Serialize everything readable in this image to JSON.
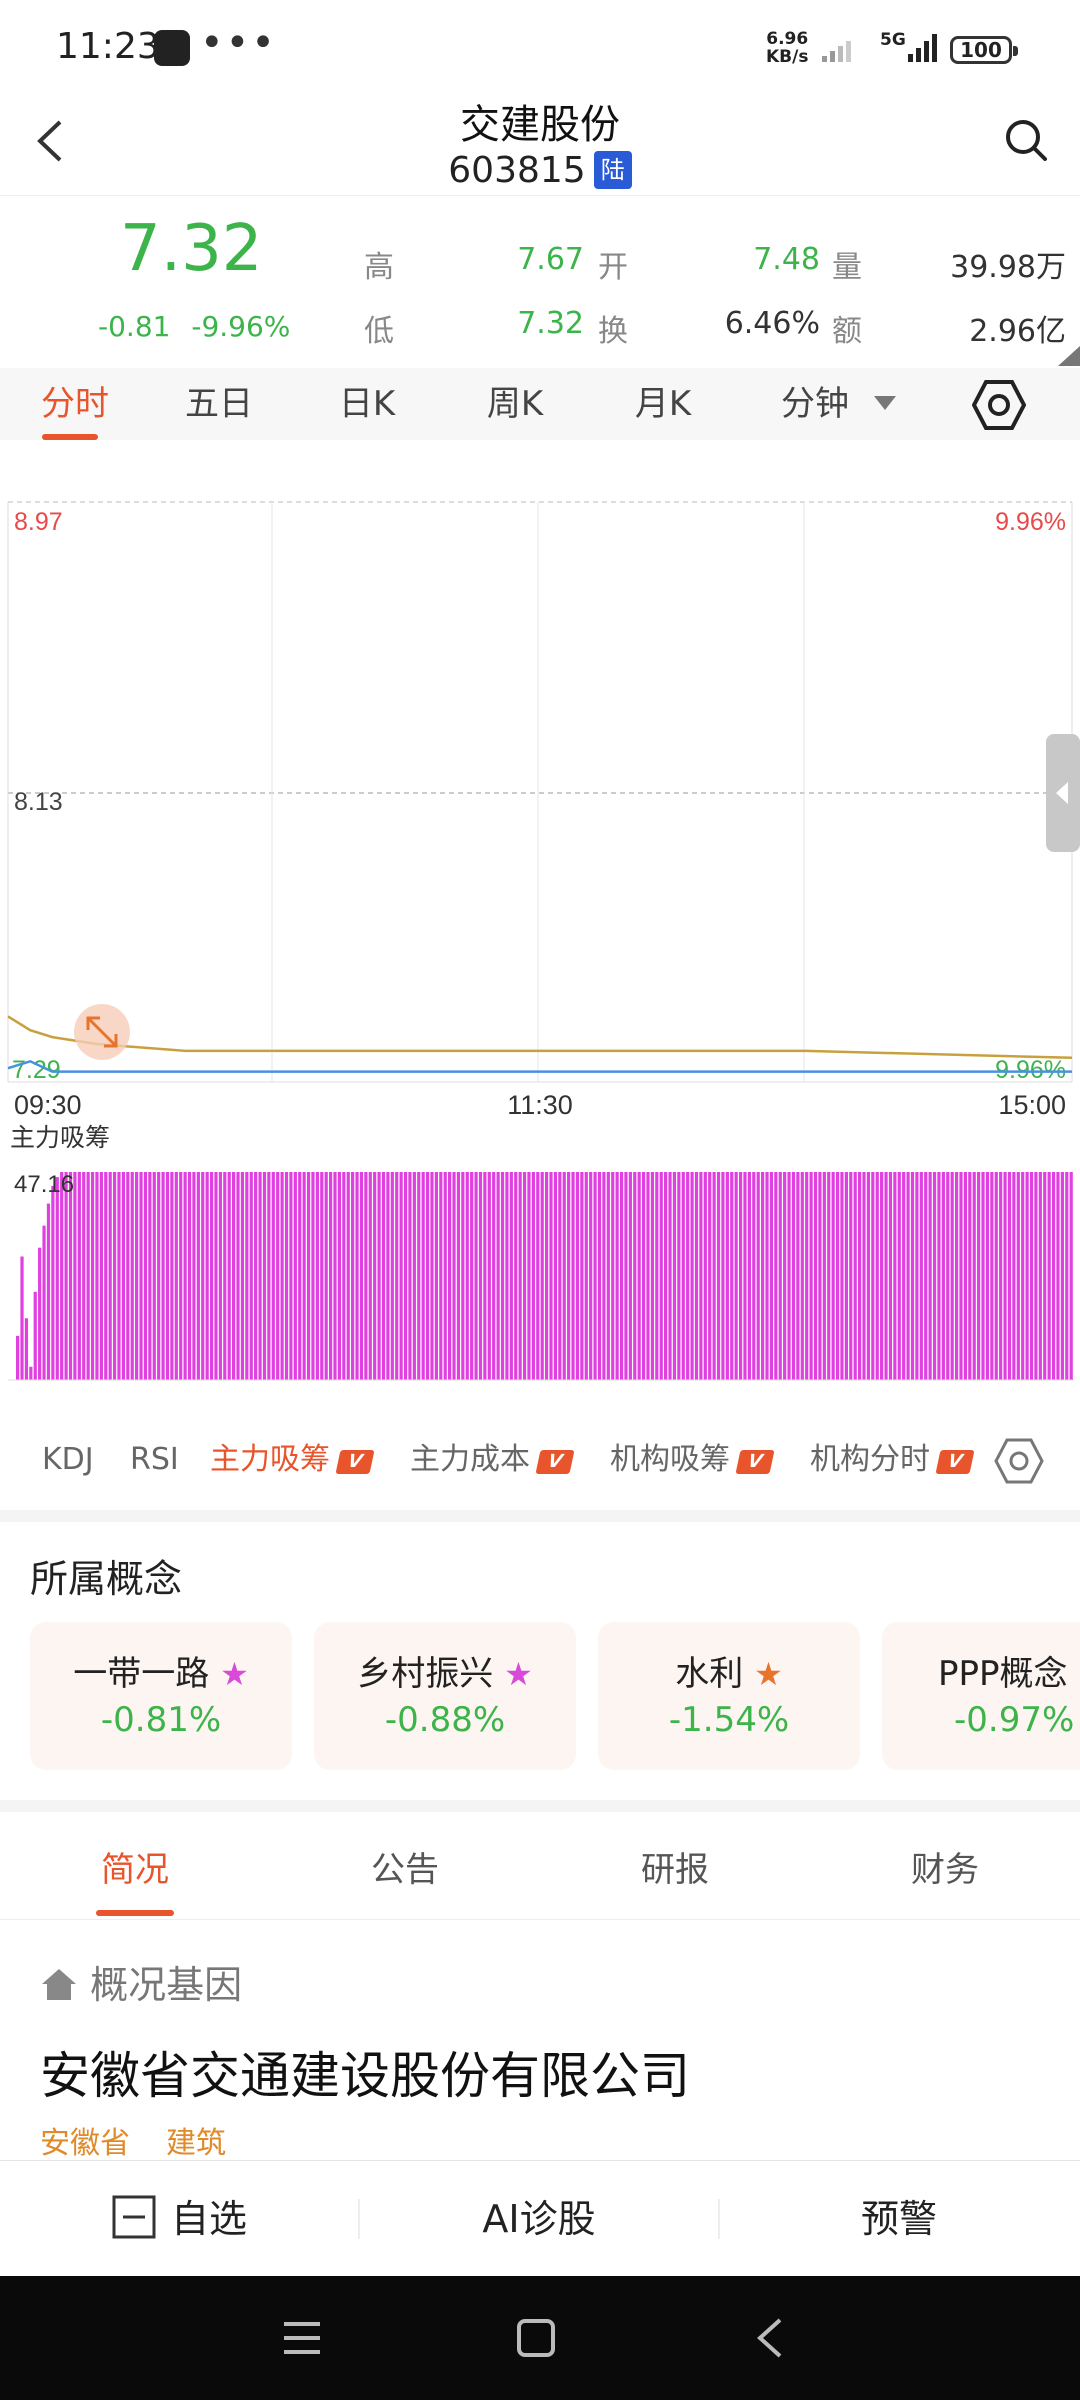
{
  "status_bar": {
    "time": "11:23",
    "dots": "•••",
    "speed_value": "6.96",
    "speed_unit": "KB/s",
    "network": "5G",
    "battery": "100"
  },
  "header": {
    "title": "交建股份",
    "code": "603815",
    "exchange_badge": "陆"
  },
  "quote": {
    "price": "7.32",
    "change": "-0.81",
    "change_pct": "-9.96%",
    "high_label": "高",
    "high": "7.67",
    "open_label": "开",
    "open": "7.48",
    "volume_label": "量",
    "volume": "39.98万",
    "low_label": "低",
    "low": "7.32",
    "turnover_label": "换",
    "turnover": "6.46%",
    "amount_label": "额",
    "amount": "2.96亿"
  },
  "chart_tabs": [
    "分时",
    "五日",
    "日K",
    "周K",
    "月K",
    "分钟"
  ],
  "chart": {
    "y_top": "8.97",
    "y_mid": "8.13",
    "y_bottom": "7.29",
    "pct_top": "9.96%",
    "pct_bottom": "-9.96%",
    "x_labels": [
      "09:30",
      "11:30",
      "15:00"
    ],
    "indicator_title": "主力吸筹",
    "indicator_max": "47.16"
  },
  "chart_data": [
    {
      "type": "line",
      "x_labels": [
        "09:30",
        "11:30",
        "15:00"
      ],
      "ylim": [
        7.29,
        8.97
      ],
      "series": [
        {
          "points": [
            [
              0,
              7.33
            ],
            [
              5,
              7.35
            ],
            [
              10,
              7.32
            ],
            [
              20,
              7.32
            ],
            [
              60,
              7.32
            ],
            [
              120,
              7.32
            ],
            [
              180,
              7.32
            ],
            [
              240,
              7.32
            ]
          ]
        },
        {
          "points": [
            [
              0,
              7.48
            ],
            [
              5,
              7.44
            ],
            [
              10,
              7.42
            ],
            [
              20,
              7.4
            ],
            [
              40,
              7.38
            ],
            [
              120,
              7.38
            ],
            [
              180,
              7.38
            ],
            [
              240,
              7.36
            ]
          ]
        }
      ]
    },
    {
      "type": "bar",
      "title": "主力吸筹",
      "ylim": [
        0,
        47.16
      ],
      "values": [
        10,
        28,
        14,
        3,
        20,
        30,
        35,
        40,
        44,
        46,
        47.16,
        47.16,
        47.16
      ]
    }
  ],
  "indicator_tabs": [
    {
      "label": "KDJ",
      "badge": ""
    },
    {
      "label": "RSI",
      "badge": ""
    },
    {
      "label": "主力吸筹",
      "badge": "V"
    },
    {
      "label": "主力成本",
      "badge": "V"
    },
    {
      "label": "机构吸筹",
      "badge": "V"
    },
    {
      "label": "机构分时",
      "badge": "V"
    }
  ],
  "concepts": {
    "title": "所属概念",
    "items": [
      {
        "name": "一带一路",
        "value": "-0.81%",
        "star_color": "#d94ad9"
      },
      {
        "name": "乡村振兴",
        "value": "-0.88%",
        "star_color": "#d94ad9"
      },
      {
        "name": "水利",
        "value": "-1.54%",
        "star_color": "#e8742b"
      },
      {
        "name": "PPP概念",
        "value": "-0.97%",
        "star_color": ""
      }
    ]
  },
  "bottom_tabs": [
    "简况",
    "公告",
    "研报",
    "财务"
  ],
  "profile": {
    "section_title": "概况基因",
    "company": "安徽省交通建设股份有限公司",
    "tags": [
      "安徽省",
      "建筑"
    ]
  },
  "bottom_bar": {
    "watchlist": "自选",
    "ai": "AI诊股",
    "alert": "预警"
  },
  "colors": {
    "up": "#e84a4a",
    "down": "#3cb44a",
    "accent": "#e8542b",
    "bars": "#e040e0"
  }
}
